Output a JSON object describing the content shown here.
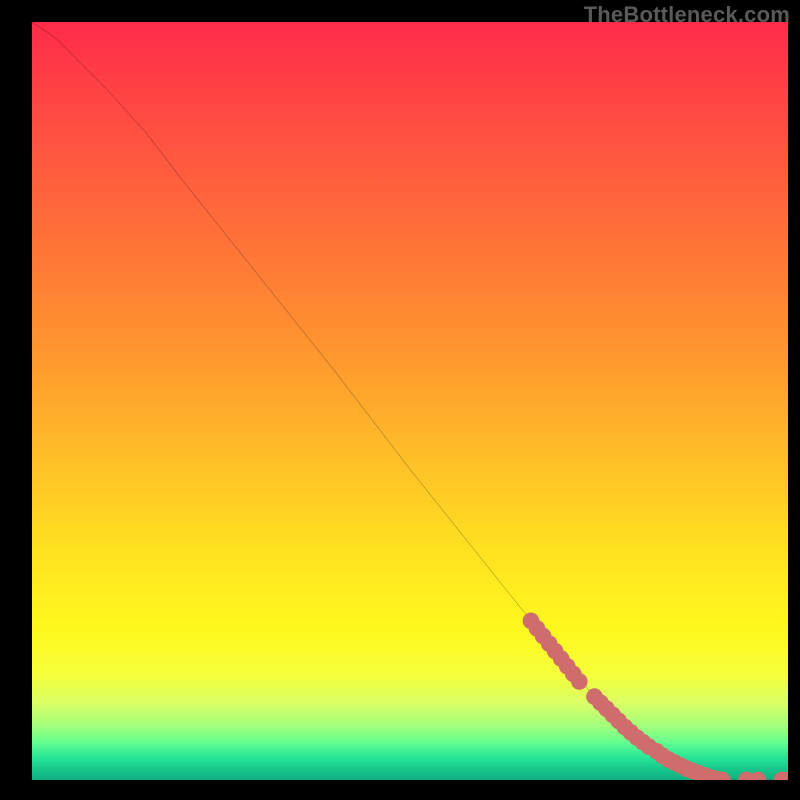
{
  "watermark": "TheBottleneck.com",
  "chart_data": {
    "type": "line",
    "title": "",
    "xlabel": "",
    "ylabel": "",
    "xlim": [
      0,
      100
    ],
    "ylim": [
      0,
      100
    ],
    "grid": false,
    "legend": false,
    "series": [
      {
        "name": "curve",
        "stroke": "#000000",
        "x": [
          0,
          3,
          6,
          10,
          15,
          20,
          30,
          40,
          50,
          60,
          66,
          70,
          74,
          78,
          82,
          86,
          89,
          91,
          93,
          94.5,
          96,
          98,
          100
        ],
        "y": [
          100,
          98,
          95,
          91,
          85.5,
          79,
          66.5,
          54,
          41,
          28.5,
          21,
          16,
          11.5,
          7.5,
          4.5,
          2.2,
          0.9,
          0,
          0,
          0,
          0,
          0,
          0
        ]
      }
    ],
    "points": {
      "name": "dots",
      "color": "#cf6d6d",
      "radius": 1.1,
      "coords": [
        [
          66,
          21
        ],
        [
          66.8,
          20
        ],
        [
          67.6,
          19
        ],
        [
          68.4,
          18
        ],
        [
          69.2,
          17
        ],
        [
          70,
          16
        ],
        [
          70.8,
          15
        ],
        [
          71.6,
          14
        ],
        [
          72.4,
          13
        ],
        [
          74.4,
          11
        ],
        [
          75.2,
          10.2
        ],
        [
          76,
          9.4
        ],
        [
          76.8,
          8.6
        ],
        [
          77.6,
          7.8
        ],
        [
          78.4,
          7
        ],
        [
          79.2,
          6.3
        ],
        [
          80,
          5.6
        ],
        [
          80.8,
          5
        ],
        [
          81.6,
          4.4
        ],
        [
          82.6,
          3.8
        ],
        [
          83.4,
          3.2
        ],
        [
          84.2,
          2.7
        ],
        [
          85,
          2.3
        ],
        [
          85.8,
          1.9
        ],
        [
          86.6,
          1.5
        ],
        [
          87.4,
          1.2
        ],
        [
          88.2,
          0.9
        ],
        [
          89,
          0.6
        ],
        [
          89.8,
          0.3
        ],
        [
          90.6,
          0.12
        ],
        [
          91.3,
          0
        ],
        [
          94.5,
          0
        ],
        [
          96,
          0
        ],
        [
          99.2,
          0
        ],
        [
          100,
          0
        ]
      ]
    }
  }
}
